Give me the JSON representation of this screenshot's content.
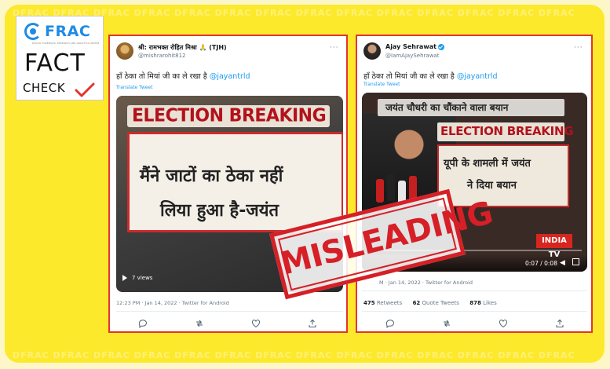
{
  "watermark": "DFRAC  DFRAC  DFRAC  DFRAC  DFRAC  DFRAC  DFRAC  DFRAC  DFRAC  DFRAC  DFRAC  DFRAC  DFRAC  DFRAC",
  "logo": {
    "brand": "FRAC",
    "tagline": "DIGITAL FORENSICS, RESEARCH AND ANALYTICS CENTRE",
    "fact": "FACT",
    "check": "CHECK"
  },
  "stamp": {
    "text": "MISLEADING",
    "color": "#d61f26"
  },
  "tweet1": {
    "name": "श्री: रामभक्त रोहित मिश्रा 🙏 (TJH)",
    "handle": "@mishrarohit812",
    "more": "···",
    "text_hindi": "हाँ ठेका तो मियां जी का ले रखा है",
    "mention": "@jayantrld",
    "translate": "Translate Tweet",
    "video": {
      "banner": "ELECTION BREAKING",
      "line1": "मैंने जाटों का ठेका नहीं",
      "line2": "लिया हुआ है-जयंत",
      "views": "7 views"
    },
    "meta": "12:23 PM · Jan 14, 2022 · Twitter for Android"
  },
  "tweet2": {
    "name": "Ajay Sehrawat",
    "handle": "@IamAjaySehrawat",
    "more": "···",
    "text_hindi": "हाँ ठेका तो मियां जी का ले रखा है",
    "mention": "@jayantrld",
    "translate": "Translate Tweet",
    "video": {
      "topbar": "जयंत चौधरी का चौंकाने वाला बयान",
      "banner": "ELECTION BREAKING",
      "line1": "यूपी के शामली में जयंत",
      "line2": "ने दिया बयान",
      "channel_logo": "INDIA TV",
      "time": "0:07 / 0:08"
    },
    "meta": "M · Jan 14, 2022 · Twitter for Android",
    "stats": {
      "retweets_count": "475",
      "retweets_label": "Retweets",
      "quotes_count": "62",
      "quotes_label": "Quote Tweets",
      "likes_count": "878",
      "likes_label": "Likes"
    }
  },
  "colors": {
    "panel": "#fde92c",
    "card_border": "#e3342f",
    "link": "#1d9bf0",
    "brand_blue": "#1f8be6"
  },
  "icons": [
    "reply-icon",
    "retweet-icon",
    "like-icon",
    "share-icon",
    "verified-icon",
    "play-icon",
    "volume-icon",
    "fullscreen-icon"
  ]
}
